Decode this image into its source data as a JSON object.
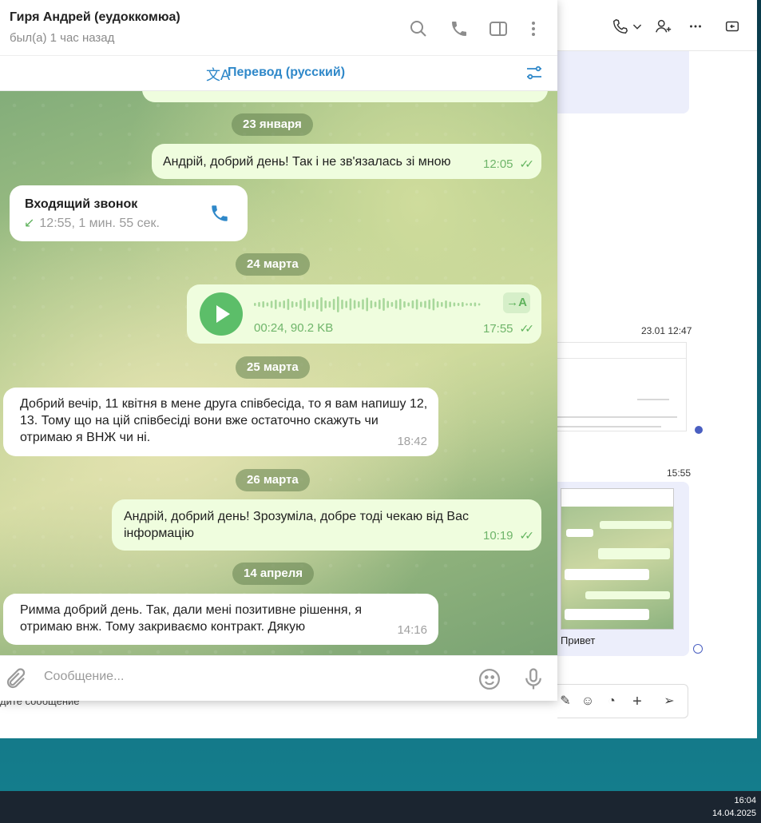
{
  "chat": {
    "contact_name": "Гиря Андрей (еудоккомюа)",
    "status": "был(а) 1 час назад",
    "translate_label": "Перевод (русский)",
    "composer_placeholder": "Сообщение...",
    "messages": [
      {
        "type": "date",
        "text": "23 января"
      },
      {
        "type": "out",
        "text": "Андрій, добрий день! Так і не зв'язалась зі мною",
        "time": "12:05"
      },
      {
        "type": "call",
        "title": "Входящий звонок",
        "detail": "12:55, 1 мин. 55 сек."
      },
      {
        "type": "date",
        "text": "24 марта"
      },
      {
        "type": "voice",
        "info": "00:24, 90.2 KB",
        "time": "17:55",
        "badge": "→A"
      },
      {
        "type": "date",
        "text": "25 марта"
      },
      {
        "type": "in",
        "text": "Добрий вечір, 11 квітня в мене друга співбесіда, то я вам напишу 12, 13. Тому що на цій співбесіді вони вже остаточно скажуть чи отримаю я ВНЖ чи ні.",
        "time": "18:42"
      },
      {
        "type": "date",
        "text": "26 марта"
      },
      {
        "type": "out",
        "text": "Андрій, добрий день! Зрозуміла, добре тоді чекаю від Вас інформацію",
        "time": "10:19"
      },
      {
        "type": "date",
        "text": "14 апреля"
      },
      {
        "type": "in",
        "text": "Римма добрий день. Так, дали мені позитивне рішення, я отримаю внж. Тому закриваємо контракт. Дякую",
        "time": "14:16"
      }
    ]
  },
  "background_app": {
    "time_a": "23.01 12:47",
    "time_b": "15:55",
    "last_message": "Привет",
    "composer_hint": "дите сообщение"
  },
  "taskbar": {
    "time": "16:04",
    "date": "14.04.2025"
  },
  "colors": {
    "accent_blue": "#2f88c9",
    "outgoing_bubble": "#effdde",
    "read_check": "#5fb25c",
    "play_button": "#5cbe69"
  }
}
